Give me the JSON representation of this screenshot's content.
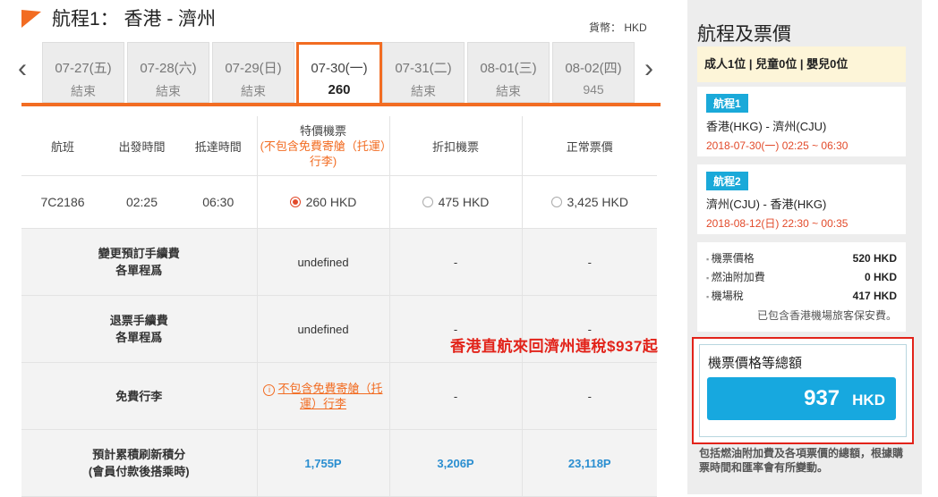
{
  "header": {
    "title": "航程1： 香港 - 濟州",
    "currency": "貨幣： HKD"
  },
  "date_tabs": [
    {
      "date": "07-27(五)",
      "status": "結束"
    },
    {
      "date": "07-28(六)",
      "status": "結束"
    },
    {
      "date": "07-29(日)",
      "status": "結束"
    },
    {
      "date": "07-30(一)",
      "status": "260"
    },
    {
      "date": "07-31(二)",
      "status": "結束"
    },
    {
      "date": "08-01(三)",
      "status": "結束"
    },
    {
      "date": "08-02(四)",
      "status": "945"
    }
  ],
  "arrows": {
    "prev": "‹",
    "next": "›"
  },
  "table": {
    "headers": {
      "flight": "航班",
      "depart": "出發時間",
      "arrive": "抵達時間",
      "special": "特價機票",
      "special_note": "(不包含免費寄艙（托運）行李)",
      "discount": "折扣機票",
      "regular": "正常票價"
    },
    "flight_row": {
      "flight": "7C2186",
      "depart": "02:25",
      "arrive": "06:30",
      "special": "260 HKD",
      "discount": "475 HKD",
      "regular": "3,425 HKD"
    },
    "change_fee": {
      "label1": "變更預訂手續費",
      "label2": "各單程爲",
      "special": "undefined",
      "discount": "-",
      "regular": "-"
    },
    "refund_fee": {
      "label1": "退票手續費",
      "label2": "各單程爲",
      "special": "undefined",
      "discount": "-",
      "regular": "-"
    },
    "baggage": {
      "label": "免費行李",
      "special1": "不包含免費寄艙（托",
      "special2": "運）行李",
      "discount": "-",
      "regular": "-"
    },
    "points": {
      "label1": "預計累積刷新積分",
      "label2": "(會員付款後搭乘時)",
      "special": "1,755P",
      "discount": "3,206P",
      "regular": "23,118P"
    }
  },
  "overlay_text": "香港直航來回濟州連稅$937起",
  "sidebar": {
    "title": "航程及票價",
    "passengers": "成人1位 | 兒童0位 | 嬰兒0位",
    "trip1": {
      "badge": "航程1",
      "route": "香港(HKG) - 濟州(CJU)",
      "time": "2018-07-30(一) 02:25 ~ 06:30"
    },
    "trip2": {
      "badge": "航程2",
      "route": "濟州(CJU) - 香港(HKG)",
      "time": "2018-08-12(日) 22:30 ~ 00:35"
    },
    "prices": [
      {
        "k": "機票價格",
        "v": "520 HKD"
      },
      {
        "k": "燃油附加費",
        "v": "0 HKD"
      },
      {
        "k": "機場稅",
        "v": "417 HKD"
      }
    ],
    "security_note": "已包含香港機場旅客保安費。",
    "total_label": "機票價格等總額",
    "total_amount": "937",
    "total_currency": "HKD",
    "footnote": "包括燃油附加費及各項票價的總額，根據購票時間和匯率會有所變動。"
  },
  "colors": {
    "accent": "#f26c22",
    "total_bar": "#17a8df",
    "highlight": "#e2231a"
  }
}
